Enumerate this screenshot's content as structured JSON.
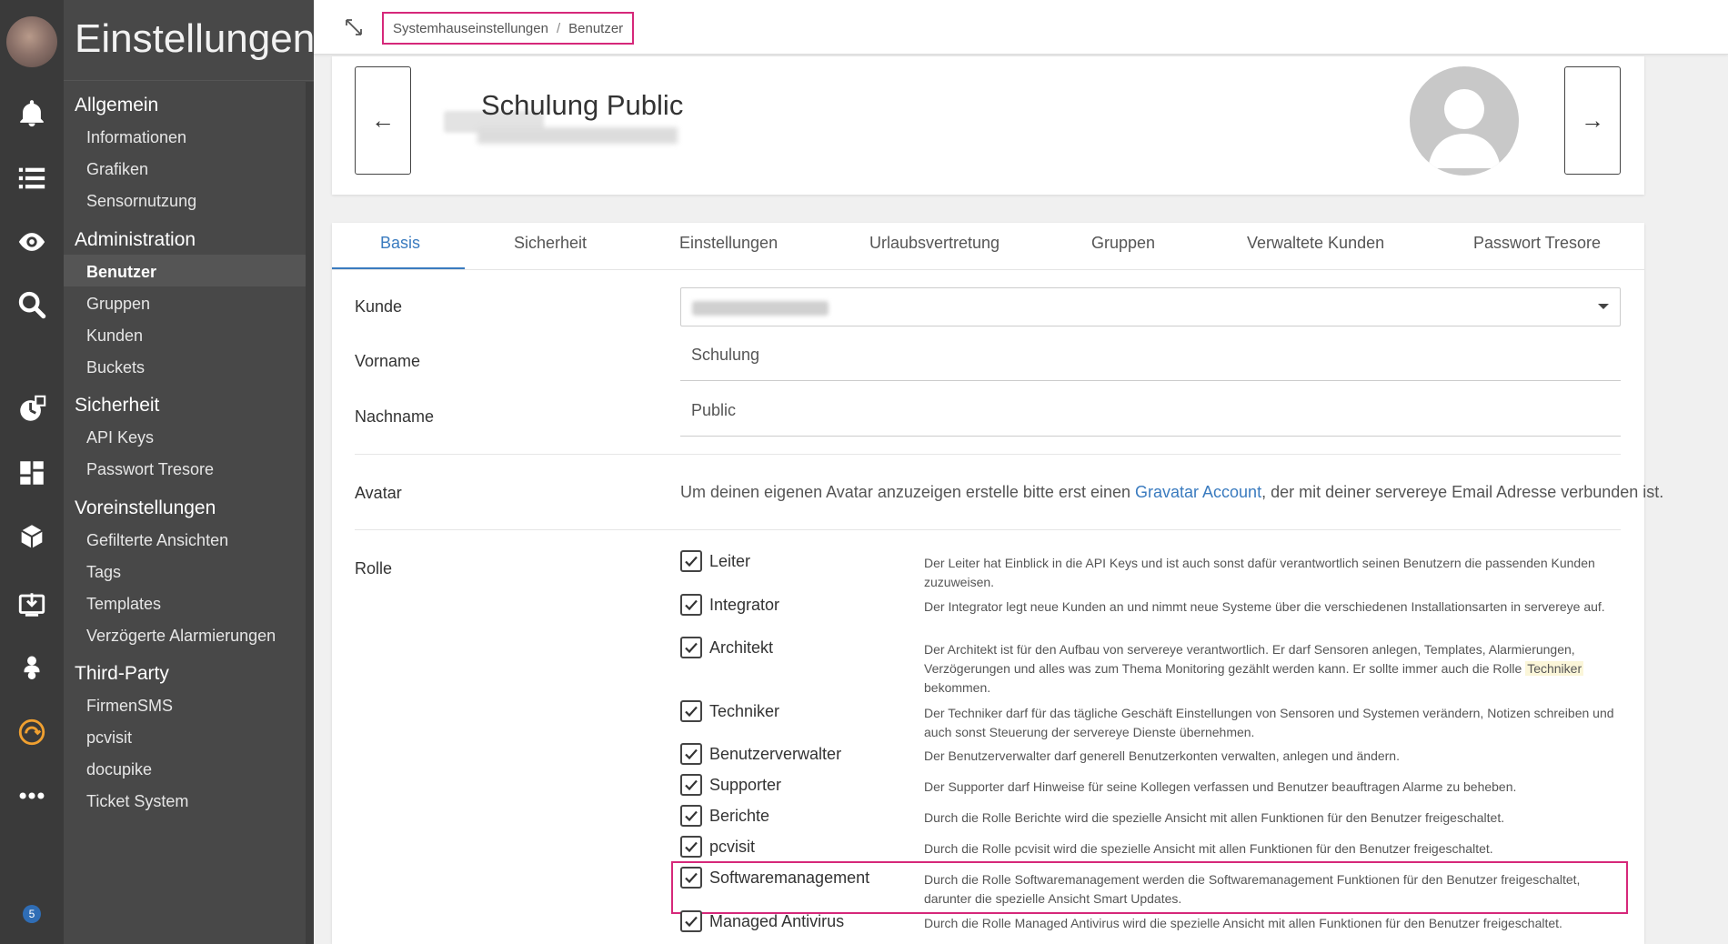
{
  "app": {
    "title": "Einstellungen",
    "notification_count": "5"
  },
  "rail_icons": [
    "bell-icon",
    "list-icon",
    "eye-icon",
    "search-icon",
    "clock-chart-icon",
    "dashboard-icon",
    "cube-icon",
    "download-screen-icon",
    "user-group-icon",
    "refresh-icon",
    "more-icon"
  ],
  "menu": {
    "sections": [
      {
        "label": "Allgemein",
        "items": [
          "Informationen",
          "Grafiken",
          "Sensornutzung"
        ]
      },
      {
        "label": "Administration",
        "items": [
          "Benutzer",
          "Gruppen",
          "Kunden",
          "Buckets"
        ]
      },
      {
        "label": "Sicherheit",
        "items": [
          "API Keys",
          "Passwort Tresore"
        ]
      },
      {
        "label": "Voreinstellungen",
        "items": [
          "Gefilterte Ansichten",
          "Tags",
          "Templates",
          "Verzögerte Alarmierungen"
        ]
      },
      {
        "label": "Third-Party",
        "items": [
          "FirmenSMS",
          "pcvisit",
          "docupike",
          "Ticket System"
        ]
      }
    ],
    "active_item": "Benutzer"
  },
  "breadcrumb": {
    "parent": "Systemhauseinstellungen",
    "separator": "/",
    "current": "Benutzer"
  },
  "header": {
    "title": "Schulung Public",
    "prev_label": "←",
    "next_label": "→"
  },
  "tabs": [
    "Basis",
    "Sicherheit",
    "Einstellungen",
    "Urlaubsvertretung",
    "Gruppen",
    "Verwaltete Kunden",
    "Passwort Tresore"
  ],
  "active_tab": "Basis",
  "form": {
    "kunde_label": "Kunde",
    "vorname_label": "Vorname",
    "vorname_value": "Schulung",
    "nachname_label": "Nachname",
    "nachname_value": "Public",
    "avatar_label": "Avatar",
    "avatar_text_before": "Um deinen eigenen Avatar anzuzeigen erstelle bitte erst einen ",
    "avatar_link": "Gravatar Account",
    "avatar_text_after": ", der mit deiner servereye Email Adresse verbunden ist.",
    "rolle_label": "Rolle"
  },
  "roles": [
    {
      "name": "Leiter",
      "checked": true,
      "desc": "Der Leiter hat Einblick in die API Keys und ist auch sonst dafür verantwortlich seinen Benutzern die passenden Kunden zuzuweisen."
    },
    {
      "name": "Integrator",
      "checked": true,
      "desc": "Der Integrator legt neue Kunden an und nimmt neue Systeme über die verschiedenen Installationsarten in servereye auf."
    },
    {
      "name": "Architekt",
      "checked": true,
      "desc": "Der Architekt ist für den Aufbau von servereye verantwortlich. Er darf Sensoren anlegen, Templates, Alarmierungen, Verzögerungen und alles was zum Thema Monitoring gezählt werden kann. Er sollte immer auch die Rolle ",
      "desc_highlight": "Techniker",
      "desc_after": " bekommen."
    },
    {
      "name": "Techniker",
      "checked": true,
      "desc": "Der Techniker darf für das tägliche Geschäft Einstellungen von Sensoren und Systemen verändern, Notizen schreiben und auch sonst Steuerung der servereye Dienste übernehmen."
    },
    {
      "name": "Benutzerverwalter",
      "checked": true,
      "desc": "Der Benutzerverwalter darf generell Benutzerkonten verwalten, anlegen und ändern."
    },
    {
      "name": "Supporter",
      "checked": true,
      "desc": "Der Supporter darf Hinweise für seine Kollegen verfassen und Benutzer beauftragen Alarme zu beheben."
    },
    {
      "name": "Berichte",
      "checked": true,
      "desc": "Durch die Rolle Berichte wird die spezielle Ansicht mit allen Funktionen für den Benutzer freigeschaltet."
    },
    {
      "name": "pcvisit",
      "checked": true,
      "desc": "Durch die Rolle pcvisit wird die spezielle Ansicht mit allen Funktionen für den Benutzer freigeschaltet."
    },
    {
      "name": "Softwaremanagement",
      "checked": true,
      "desc": "Durch die Rolle Softwaremanagement werden die Softwaremanagement Funktionen für den Benutzer freigeschaltet, darunter die spezielle Ansicht Smart Updates."
    },
    {
      "name": "Managed Antivirus",
      "checked": true,
      "desc": "Durch die Rolle Managed Antivirus wird die spezielle Ansicht mit allen Funktionen für den Benutzer freigeschaltet."
    }
  ],
  "colors": {
    "accent": "#3a7bbf",
    "highlight_border": "#d6287a",
    "rail": "#3a3a3a",
    "menu": "#484848"
  }
}
